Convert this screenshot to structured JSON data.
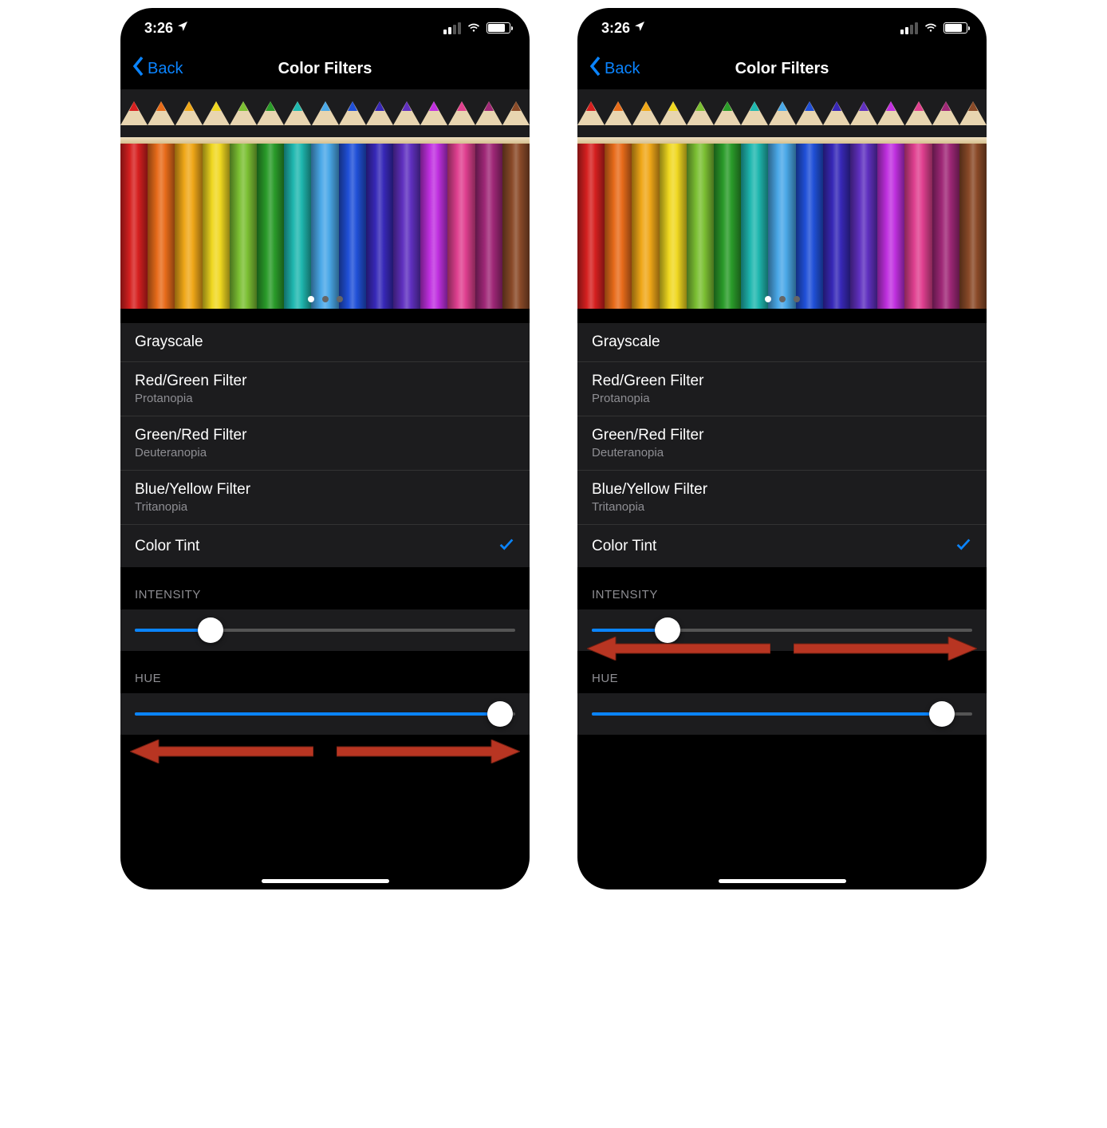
{
  "screens": [
    {
      "status": {
        "time": "3:26"
      },
      "nav": {
        "back_label": "Back",
        "title": "Color Filters"
      },
      "pager_active": 0,
      "pager_count": 3,
      "pencil_colors": [
        "#d62020",
        "#e86c1a",
        "#f0a818",
        "#f0d820",
        "#7cc033",
        "#2a9c2a",
        "#1fb8b0",
        "#4aa8e8",
        "#2050d8",
        "#3828b8",
        "#6030c0",
        "#c030e0",
        "#e04090",
        "#a02878",
        "#8a4a28"
      ],
      "list": {
        "items": [
          {
            "label": "Grayscale",
            "sub": "",
            "selected": false
          },
          {
            "label": "Red/Green Filter",
            "sub": "Protanopia",
            "selected": false
          },
          {
            "label": "Green/Red Filter",
            "sub": "Deuteranopia",
            "selected": false
          },
          {
            "label": "Blue/Yellow Filter",
            "sub": "Tritanopia",
            "selected": false
          },
          {
            "label": "Color Tint",
            "sub": "",
            "selected": true
          }
        ]
      },
      "sliders": {
        "intensity": {
          "label": "INTENSITY",
          "value_pct": 20
        },
        "hue": {
          "label": "HUE",
          "value_pct": 96
        }
      },
      "arrows_below": "hue"
    },
    {
      "status": {
        "time": "3:26"
      },
      "nav": {
        "back_label": "Back",
        "title": "Color Filters"
      },
      "pager_active": 0,
      "pager_count": 3,
      "pencil_colors": [
        "#d62020",
        "#e86c1a",
        "#f0a818",
        "#f0d820",
        "#7cc033",
        "#2a9c2a",
        "#1fb8b0",
        "#4aa8e8",
        "#2050d8",
        "#3828b8",
        "#6030c0",
        "#c030e0",
        "#e04090",
        "#a02878",
        "#8a4a28"
      ],
      "list": {
        "items": [
          {
            "label": "Grayscale",
            "sub": "",
            "selected": false
          },
          {
            "label": "Red/Green Filter",
            "sub": "Protanopia",
            "selected": false
          },
          {
            "label": "Green/Red Filter",
            "sub": "Deuteranopia",
            "selected": false
          },
          {
            "label": "Blue/Yellow Filter",
            "sub": "Tritanopia",
            "selected": false
          },
          {
            "label": "Color Tint",
            "sub": "",
            "selected": true
          }
        ]
      },
      "sliders": {
        "intensity": {
          "label": "INTENSITY",
          "value_pct": 20
        },
        "hue": {
          "label": "HUE",
          "value_pct": 92
        }
      },
      "arrows_below": "intensity"
    }
  ]
}
